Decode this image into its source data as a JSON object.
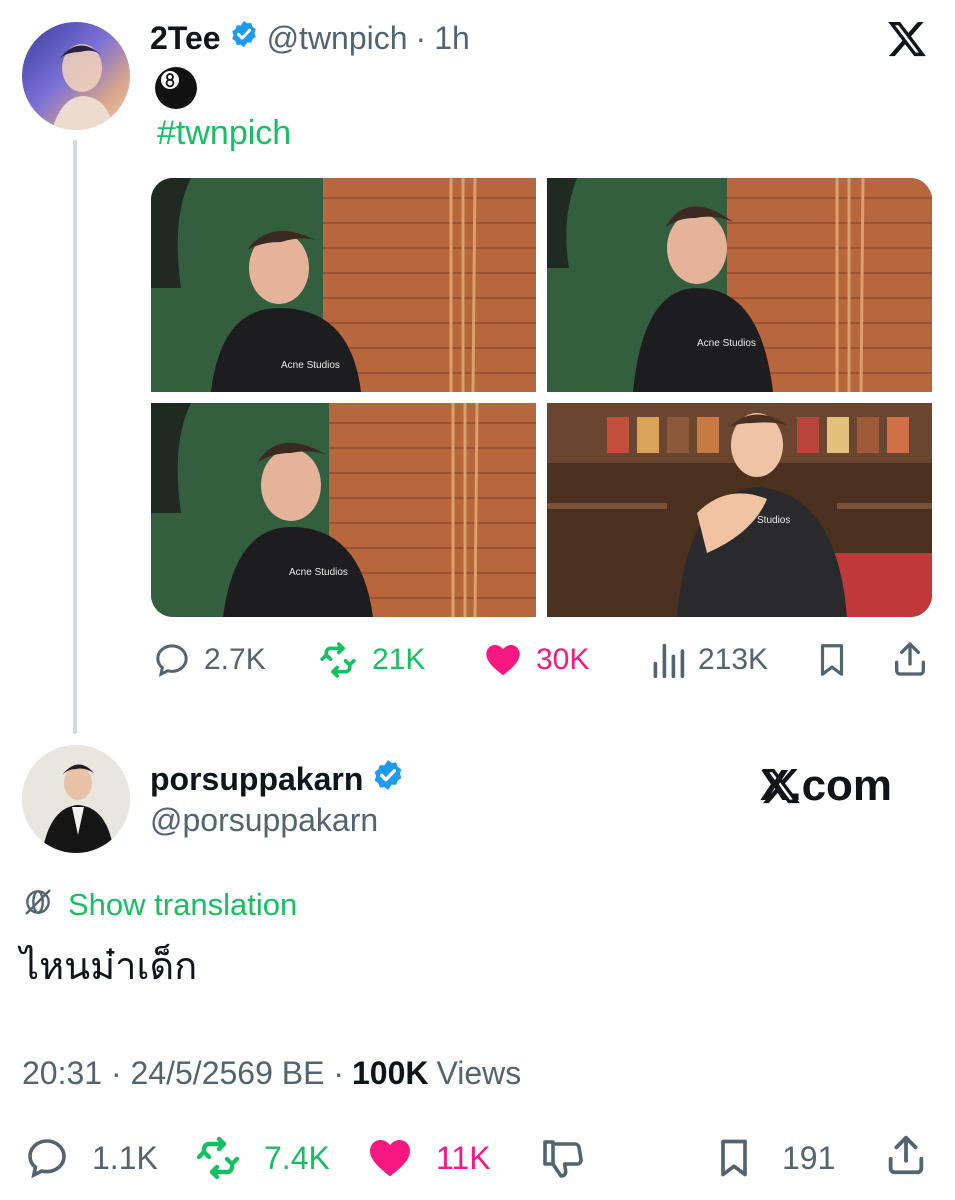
{
  "tweet1": {
    "display_name": "2Tee",
    "handle": "@twnpich",
    "time": "1h",
    "emoji": "🎱",
    "hashtag": "#twnpich",
    "actions": {
      "replies": "2.7K",
      "retweets": "21K",
      "likes": "30K",
      "views": "213K"
    }
  },
  "tweet2": {
    "display_name": "porsuppakarn",
    "handle": "@porsuppakarn",
    "show_translation": "Show translation",
    "text": "ไหนม๋าเด็ก",
    "timestamp": "20:31 · 24/5/2569 BE ·",
    "views_count": "100K",
    "views_label": "Views",
    "actions": {
      "replies": "1.1K",
      "retweets": "7.4K",
      "likes": "11K",
      "bookmarks": "191"
    }
  },
  "brand": {
    "x_logo": "x-logo-icon",
    "site": "X.com"
  },
  "colors": {
    "green": "#17bf63",
    "pink": "#f91880",
    "verified": "#1d9bf0",
    "muted": "#536471"
  }
}
